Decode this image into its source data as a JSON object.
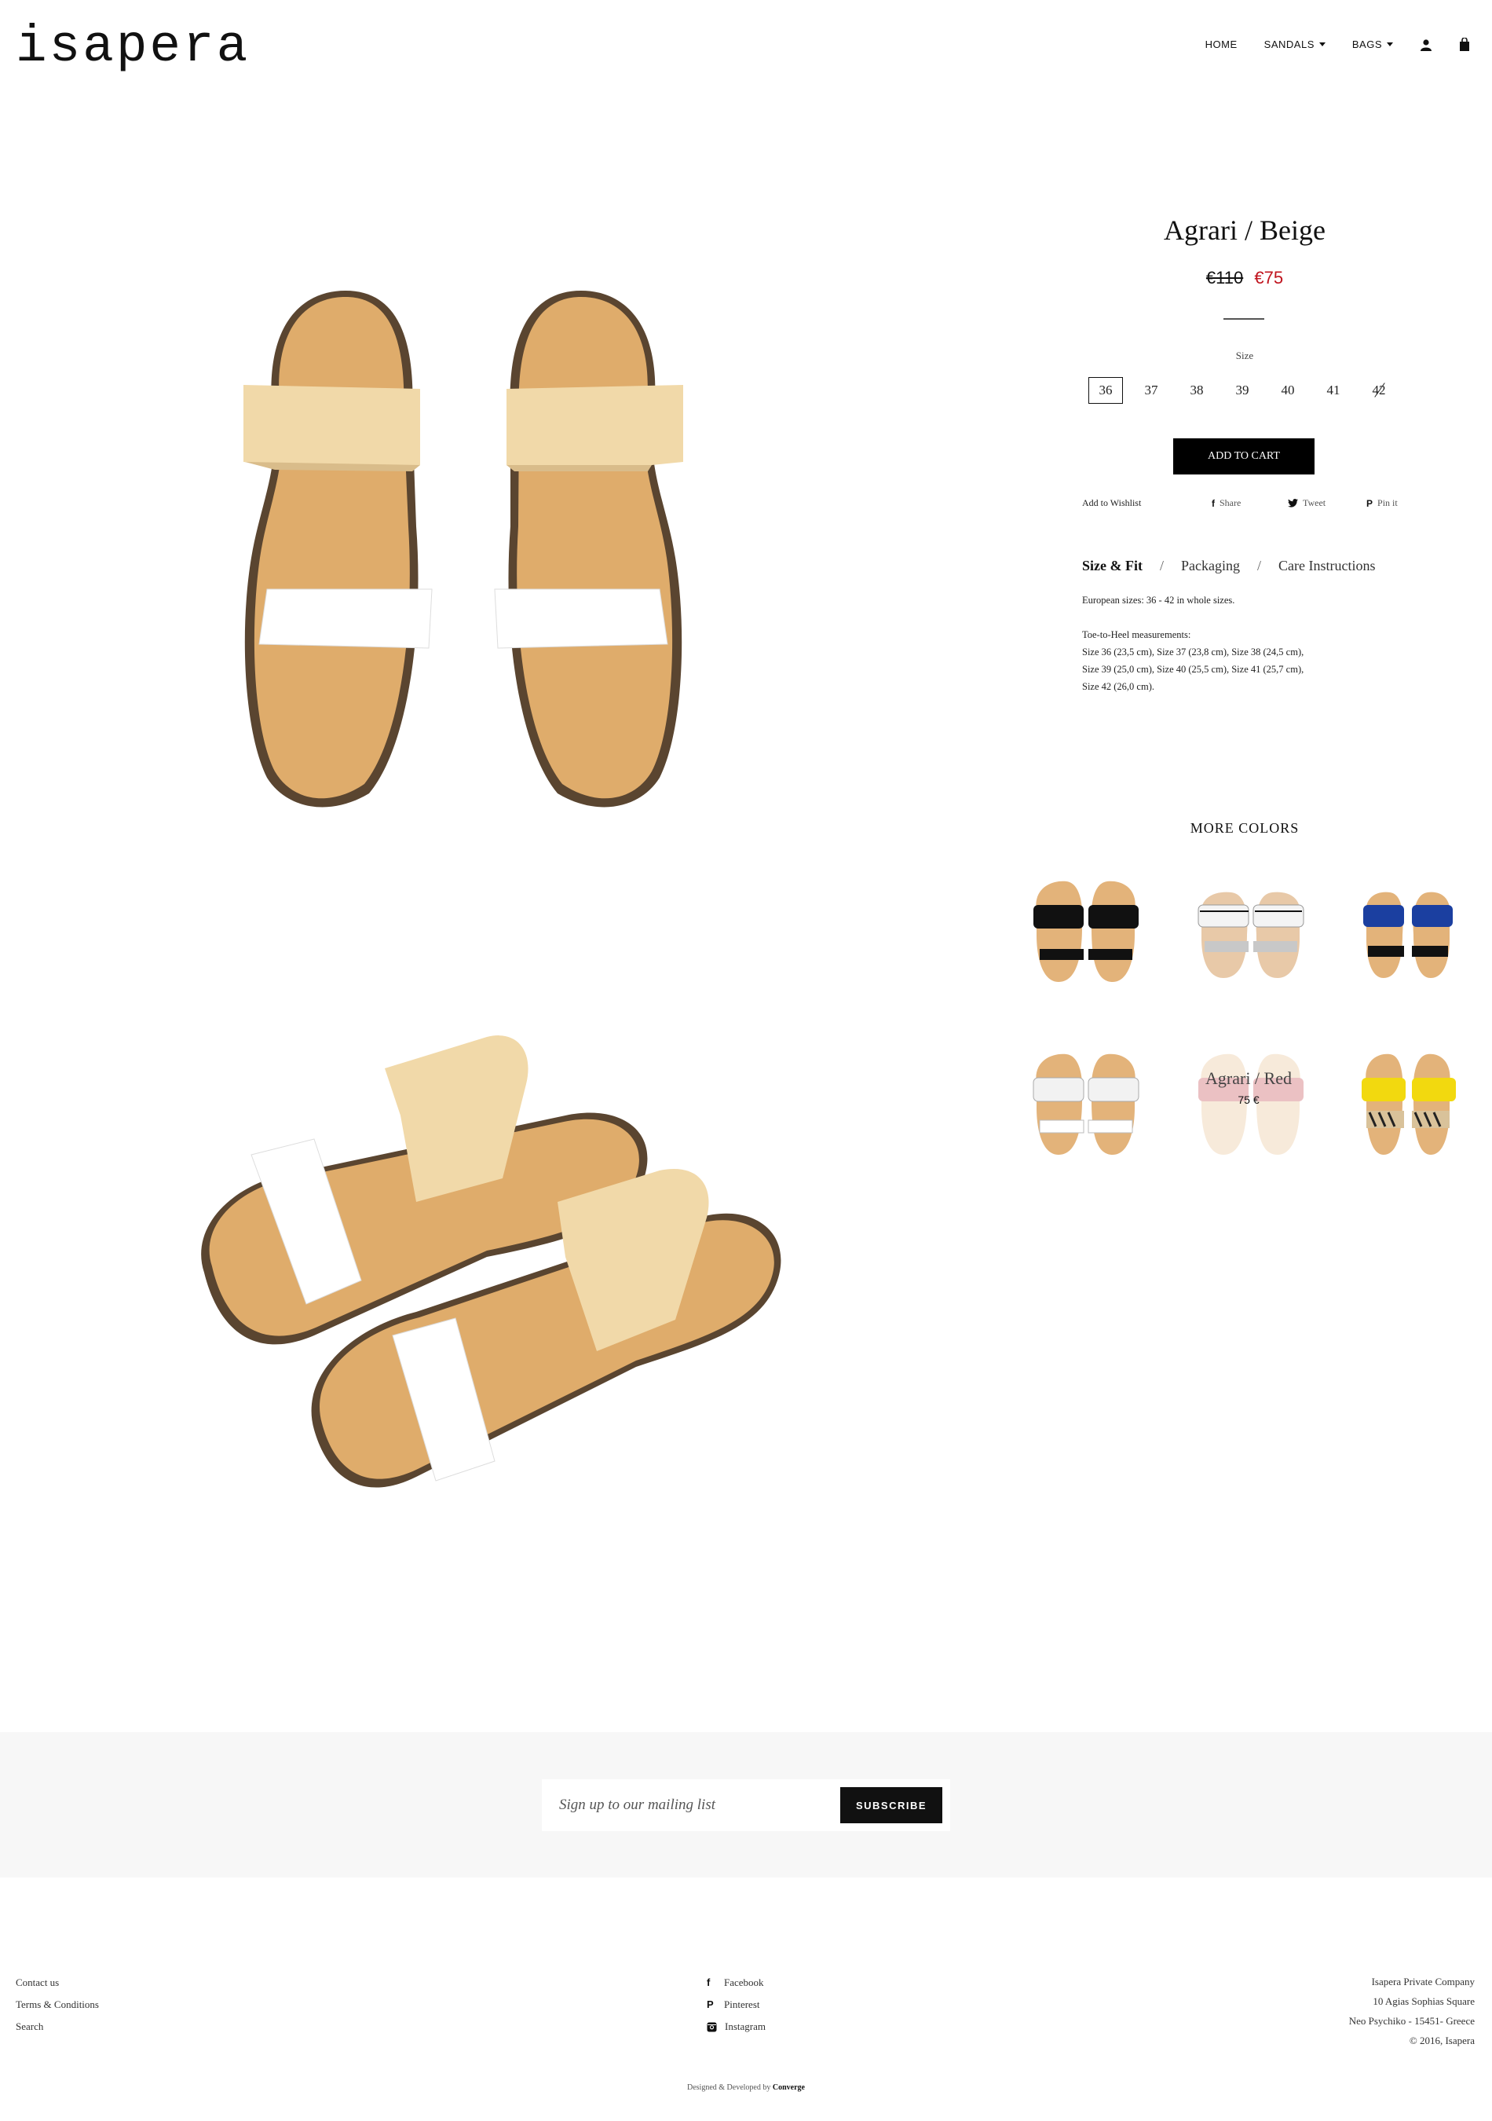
{
  "header": {
    "logo": "isapera",
    "nav": [
      {
        "label": "HOME"
      },
      {
        "label": "SANDALS"
      },
      {
        "label": "BAGS"
      }
    ]
  },
  "product": {
    "title": "Agrari / Beige",
    "old_price": "€110",
    "price": "€75",
    "size_label": "Size",
    "sizes": [
      "36",
      "37",
      "38",
      "39",
      "40",
      "41",
      "42"
    ],
    "selected_size": "36",
    "unavailable_size": "42",
    "add_to_cart": "ADD TO CART",
    "wishlist": "Add to Wishlist",
    "share": "Share",
    "tweet": "Tweet",
    "pin": "Pin it",
    "tabs": [
      "Size & Fit",
      "Packaging",
      "Care Instructions"
    ],
    "description": {
      "line1": "European sizes: 36 - 42 in whole sizes.",
      "line2": "Toe-to-Heel measurements:",
      "line3": "Size 36 (23,5 cm), Size 37 (23,8 cm), Size 38 (24,5 cm),",
      "line4": "Size 39 (25,0 cm), Size 40 (25,5 cm), Size 41 (25,7 cm),",
      "line5": "Size 42 (26,0 cm)."
    }
  },
  "more_colors": {
    "title": "MORE COLORS",
    "hover_name": "Agrari / Red",
    "hover_price": "75 €"
  },
  "newsletter": {
    "placeholder": "Sign up to our mailing list",
    "button": "SUBSCRIBE"
  },
  "footer": {
    "links": [
      "Contact us",
      "Terms & Conditions",
      "Search"
    ],
    "social": [
      "Facebook",
      "Pinterest",
      "Instagram"
    ],
    "address": [
      "Isapera Private Company",
      "10 Agias Sophias Square",
      "Neo Psychiko - 15451- Greece",
      "© 2016, Isapera"
    ],
    "credit_prefix": "Designed & Developed by",
    "credit_name": "Converge"
  },
  "colors": {
    "accent_price": "#c0141e",
    "button_bg": "#000000",
    "newsletter_bg": "#f7f7f7"
  }
}
